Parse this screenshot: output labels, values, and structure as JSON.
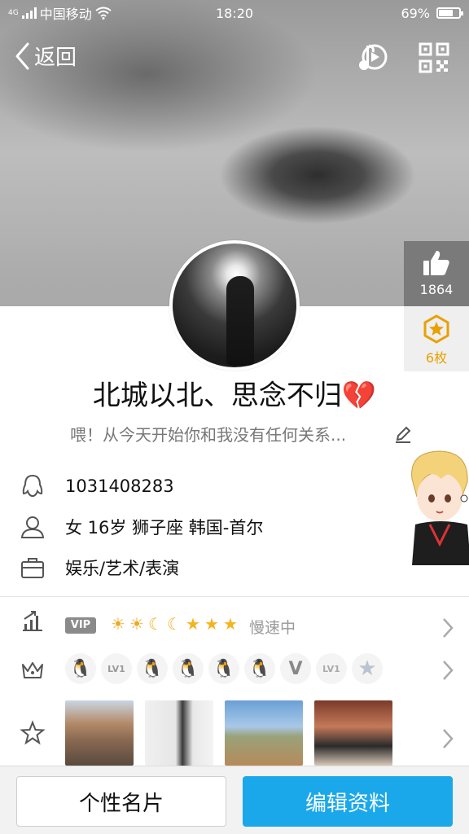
{
  "status_bar": {
    "network_label": "4G",
    "carrier": "中国移动",
    "time": "18:20",
    "battery_text": "69%",
    "battery_level": 0.69
  },
  "top_bar": {
    "back_label": "返回",
    "icons": [
      "music-icon",
      "qr-code-icon"
    ]
  },
  "side_badges": {
    "likes": "1864",
    "medals": "6枚"
  },
  "profile": {
    "nickname": "北城以北、思念不归",
    "nickname_emoji": "💔",
    "signature": "喂！从今天开始你和我没有任何关系..."
  },
  "info": {
    "qq_number": "1031408283",
    "personal": "女  16岁  狮子座  韩国-首尔",
    "occupation": "娱乐/艺术/表演"
  },
  "level_row": {
    "vip_label": "VIP",
    "level_icons": [
      "☀",
      "☀",
      "☾",
      "☾",
      "★",
      "★",
      "★"
    ],
    "speed_text": "慢速中"
  },
  "badges_row": {
    "badges": [
      "🐧",
      "LV1",
      "🐧",
      "🐧",
      "🐧",
      "🐧",
      "V",
      "LV1",
      "★"
    ]
  },
  "bottom": {
    "card_button": "个性名片",
    "edit_button": "编辑资料"
  },
  "colors": {
    "accent": "#1ba8ea",
    "medal": "#e8a100",
    "heart": "#e23b3b"
  }
}
